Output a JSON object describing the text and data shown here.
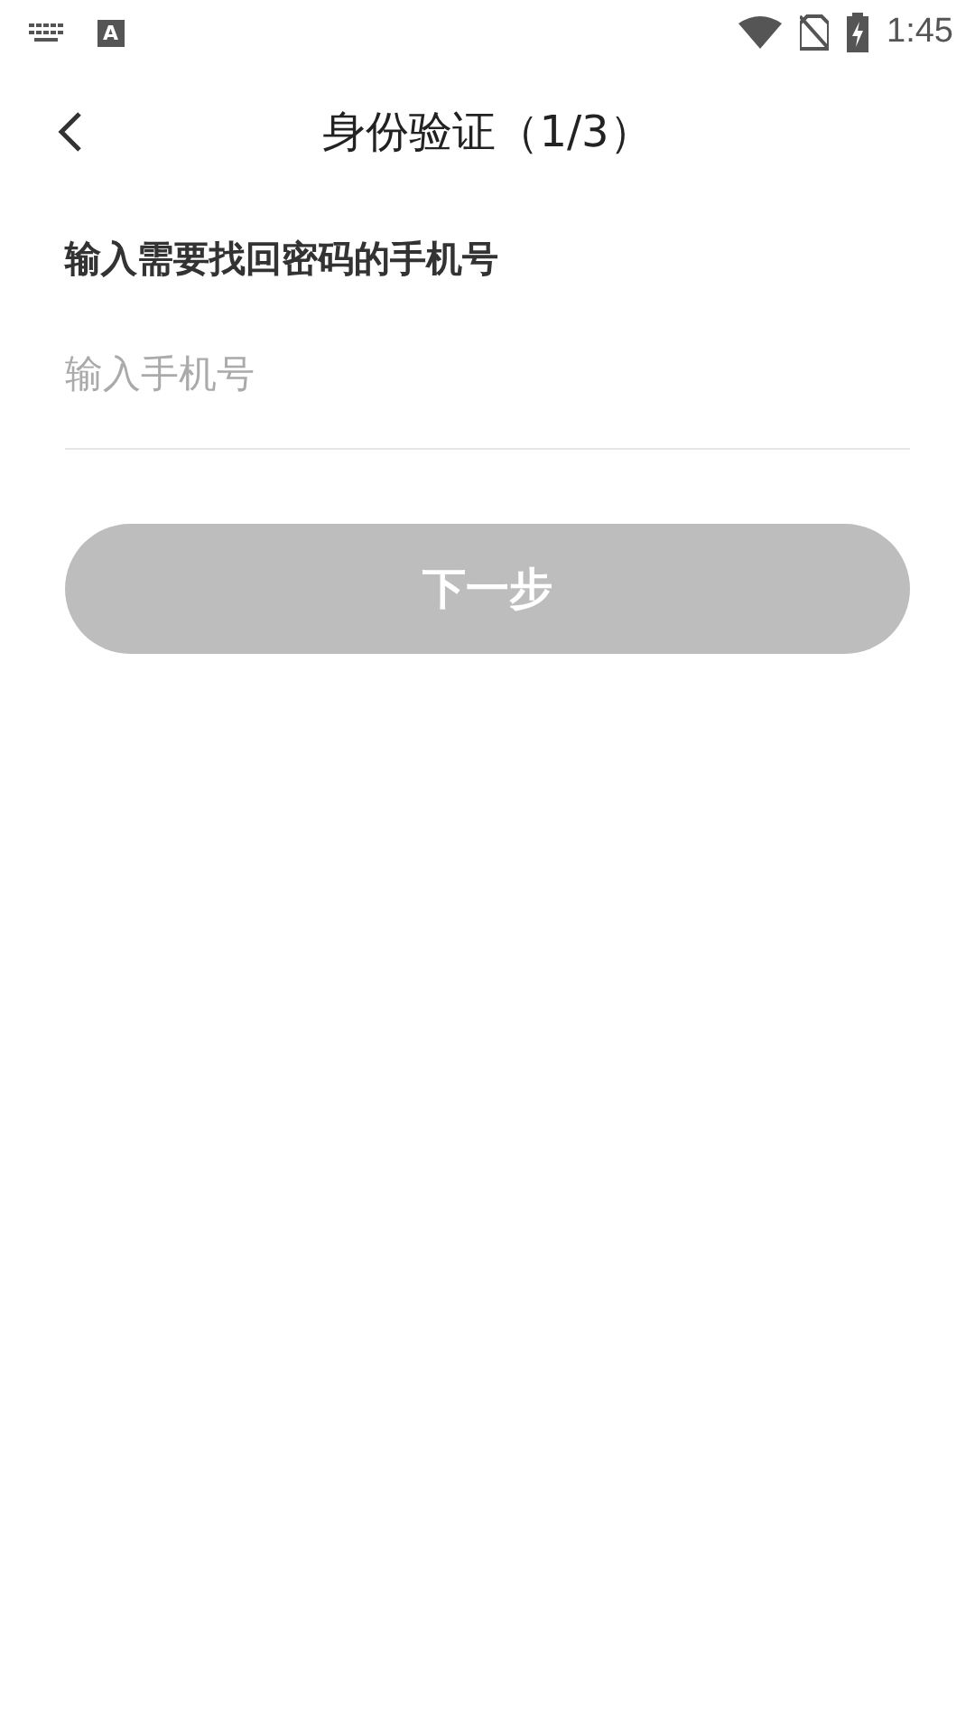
{
  "status_bar": {
    "app_badge": "A",
    "time": "1:45"
  },
  "header": {
    "title": "身份验证（1/3）"
  },
  "prompt": "输入需要找回密码的手机号",
  "phone_field": {
    "placeholder": "输入手机号"
  },
  "next_button": {
    "label": "下一步",
    "disabled": true
  }
}
